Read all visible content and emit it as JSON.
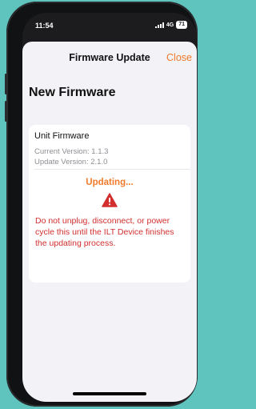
{
  "status_bar": {
    "time": "11:54",
    "network": "4G",
    "battery": "71"
  },
  "nav": {
    "title": "Firmware Update",
    "close_label": "Close"
  },
  "page": {
    "title": "New Firmware"
  },
  "firmware": {
    "title": "Unit Firmware",
    "current_version": "Current Version: 1.1.3",
    "update_version": "Update Version: 2.1.0",
    "status": "Updating...",
    "warning_icon": "warning-triangle-icon",
    "warning": "Do not unplug, disconnect, or power cycle this until the ILT Device finishes the updating process."
  },
  "colors": {
    "accent": "#f27a2a",
    "warning": "#d32f2f",
    "background": "#5fc4bd"
  }
}
